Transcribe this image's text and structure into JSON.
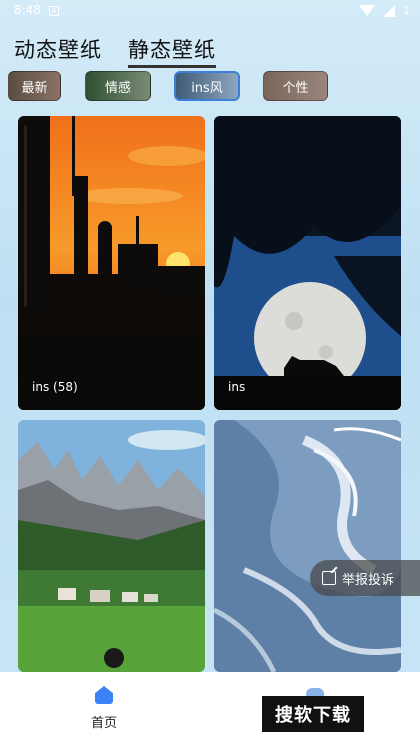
{
  "status": {
    "time": "8:48",
    "notif": "A",
    "battery": "1"
  },
  "top_tabs": [
    {
      "label": "动态壁纸"
    },
    {
      "label": "静态壁纸"
    }
  ],
  "chips": [
    {
      "label": "最新"
    },
    {
      "label": "情感"
    },
    {
      "label": "ins风"
    },
    {
      "label": "个性"
    }
  ],
  "cards": [
    {
      "label": "ins (58)"
    },
    {
      "label": "ins"
    },
    {
      "label": ""
    },
    {
      "label": ""
    }
  ],
  "report": {
    "label": "举报投诉"
  },
  "nav": {
    "home_label": "首页"
  },
  "watermark": "搜软下载",
  "colors": {
    "accent": "#3b82f6",
    "active_chip_border": "#3c7fd8"
  }
}
